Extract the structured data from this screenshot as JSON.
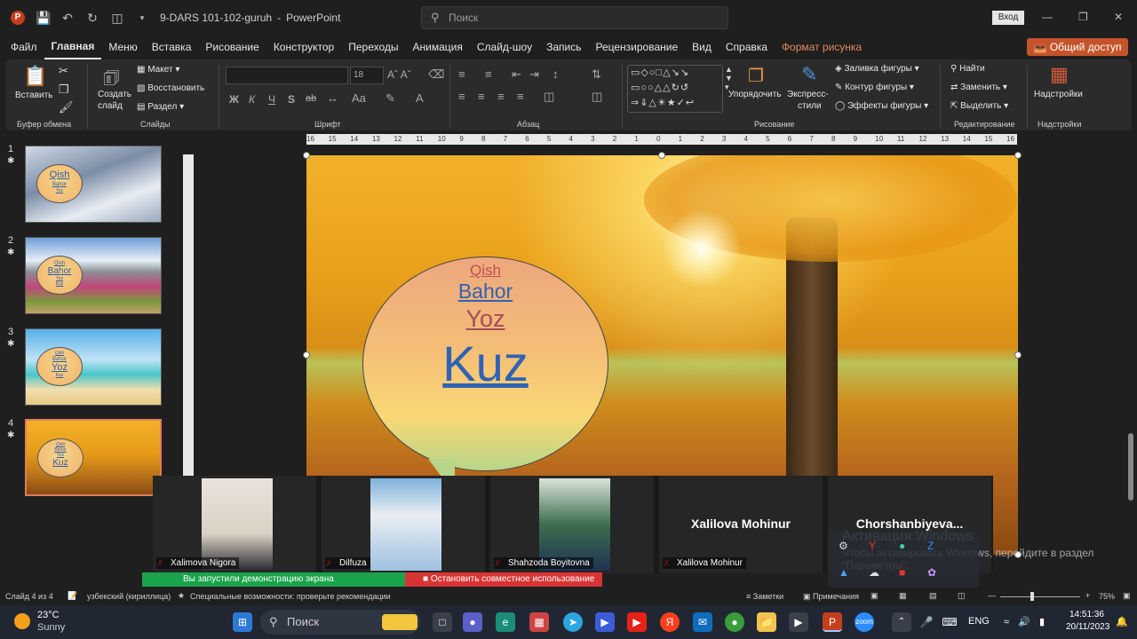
{
  "titlebar": {
    "file_name": "9-DARS 101-102-guruh",
    "app": "PowerPoint",
    "search_placeholder": "Поиск",
    "signin": "Вход"
  },
  "menu": {
    "items": [
      "Файл",
      "Главная",
      "Меню",
      "Вставка",
      "Рисование",
      "Конструктор",
      "Переходы",
      "Анимация",
      "Слайд-шоу",
      "Запись",
      "Рецензирование",
      "Вид",
      "Справка"
    ],
    "format_tab": "Формат рисунка",
    "share": "Общий доступ"
  },
  "ribbon": {
    "clipboard": {
      "paste": "Вставить",
      "label": "Буфер обмена"
    },
    "slides": {
      "new_slide_1": "Создать",
      "new_slide_2": "слайд",
      "layout": "Макет",
      "reset": "Восстановить",
      "section": "Раздел",
      "label": "Слайды"
    },
    "font": {
      "size": "18",
      "label": "Шрифт",
      "bold": "Ж",
      "italic": "К",
      "underline": "Ч",
      "shadow": "S",
      "strike": "ab"
    },
    "paragraph": {
      "label": "Абзац"
    },
    "drawing": {
      "arrange": "Упорядочить",
      "quick_styles_1": "Экспресс-",
      "quick_styles_2": "стили",
      "fill": "Заливка фигуры",
      "outline": "Контур фигуры",
      "effects": "Эффекты фигуры",
      "label": "Рисование"
    },
    "editing": {
      "find": "Найти",
      "replace": "Заменить",
      "select": "Выделить",
      "label": "Редактирование"
    },
    "addins": {
      "button": "Надстройки",
      "label": "Надстройки"
    }
  },
  "thumbnails": [
    {
      "num": "1",
      "lines": [
        "Qish",
        "Bahor",
        "Yoz"
      ]
    },
    {
      "num": "2",
      "lines": [
        "Qish",
        "Bahor",
        "Yoz",
        "Kuz"
      ]
    },
    {
      "num": "3",
      "lines": [
        "Qish",
        "Bahor",
        "Yoz",
        "Kuz"
      ]
    },
    {
      "num": "4",
      "lines": [
        "Qish",
        "Bahor",
        "Yoz",
        "Kuz"
      ]
    }
  ],
  "ruler_h": [
    "16",
    "15",
    "14",
    "13",
    "12",
    "11",
    "10",
    "9",
    "8",
    "7",
    "6",
    "5",
    "4",
    "3",
    "2",
    "1",
    "0",
    "1",
    "2",
    "3",
    "4",
    "5",
    "6",
    "7",
    "8",
    "9",
    "10",
    "11",
    "12",
    "13",
    "14",
    "15",
    "16"
  ],
  "slide": {
    "words": [
      "Qish",
      "Bahor",
      "Yoz",
      "Kuz"
    ]
  },
  "participants": [
    {
      "name": "Xalimova Nigora",
      "video": true
    },
    {
      "name": "Dilfuza",
      "video": true
    },
    {
      "name": "Shahzoda Boyitovna",
      "video": true
    },
    {
      "name": "Xalilova Mohinur",
      "video": false,
      "display": "Xalilova Mohinur"
    },
    {
      "name": "Chorshanbiyeva...",
      "video": false,
      "display": "Chorshanbiyeva..."
    }
  ],
  "share_bar": {
    "status": "Вы запустили демонстрацию экрана",
    "stop": "Остановить совместное использование"
  },
  "activation": {
    "title": "Активация Windows",
    "line1": "Чтобы активировать Windows, перейдите в раздел",
    "line2": "\"Параметры\"."
  },
  "statusbar": {
    "slide": "Слайд 4 из 4",
    "language": "узбекский (кириллица)",
    "accessibility": "Специальные возможности: проверьте рекомендации",
    "notes": "Заметки",
    "comments": "Примечания",
    "zoom": "75%"
  },
  "taskbar": {
    "temp": "23°C",
    "weather": "Sunny",
    "search": "Поиск",
    "lang": "ENG",
    "time": "14:51:36",
    "date": "20/11/2023"
  }
}
